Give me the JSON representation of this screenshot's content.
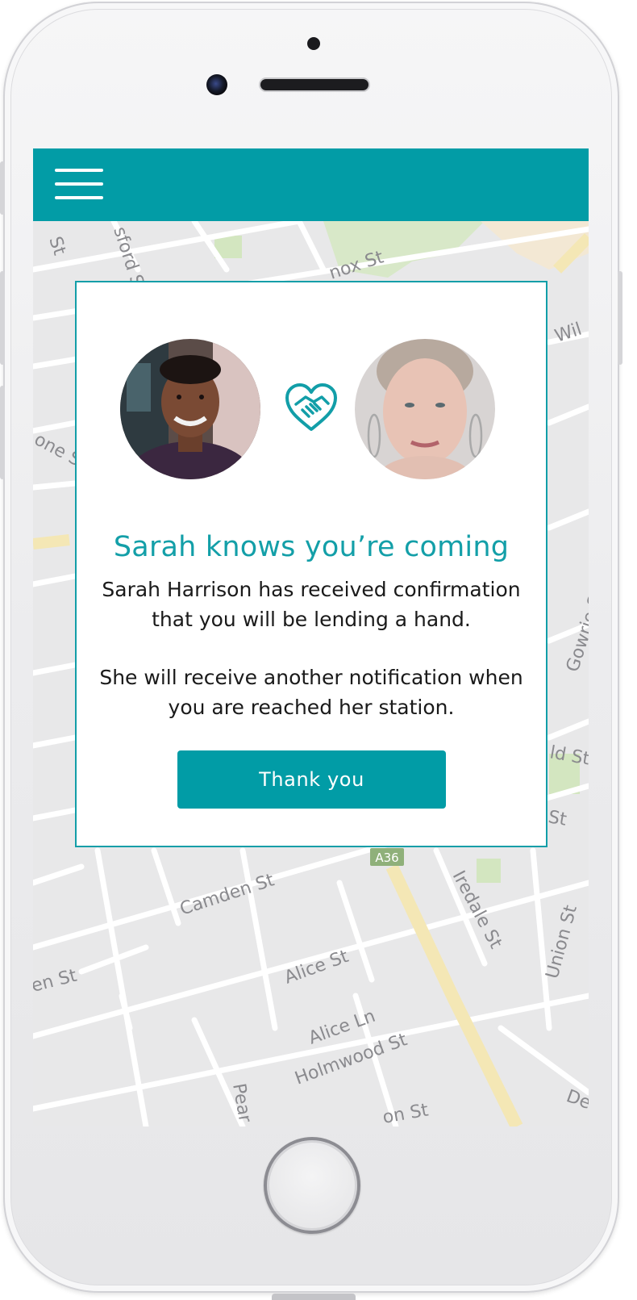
{
  "device": {
    "name": "iPhone frame"
  },
  "appbar": {
    "color": "#029ca6",
    "menu_icon": "hamburger-menu-icon"
  },
  "map": {
    "streets": [
      "nox St",
      "Wil",
      "one S",
      "Gowrie S",
      "ld St",
      "St",
      "A36",
      "Camden St",
      "Iredale St",
      "Union St",
      "en St",
      "Alice St",
      "Alice Ln",
      "Holmwood St",
      "Pear",
      "on St",
      "De",
      "St",
      "sford St"
    ]
  },
  "modal": {
    "left_avatar": "young-man-avatar",
    "right_avatar": "older-woman-avatar",
    "connector_icon": "handshake-heart-icon",
    "title": "Sarah knows you’re coming",
    "paragraph1": "Sarah Harrison has received confirmation that you will be lending a hand.",
    "paragraph2": "She will receive another notification when you are reached her station.",
    "button_label": "Thank you",
    "accent_color": "#139fa8"
  }
}
